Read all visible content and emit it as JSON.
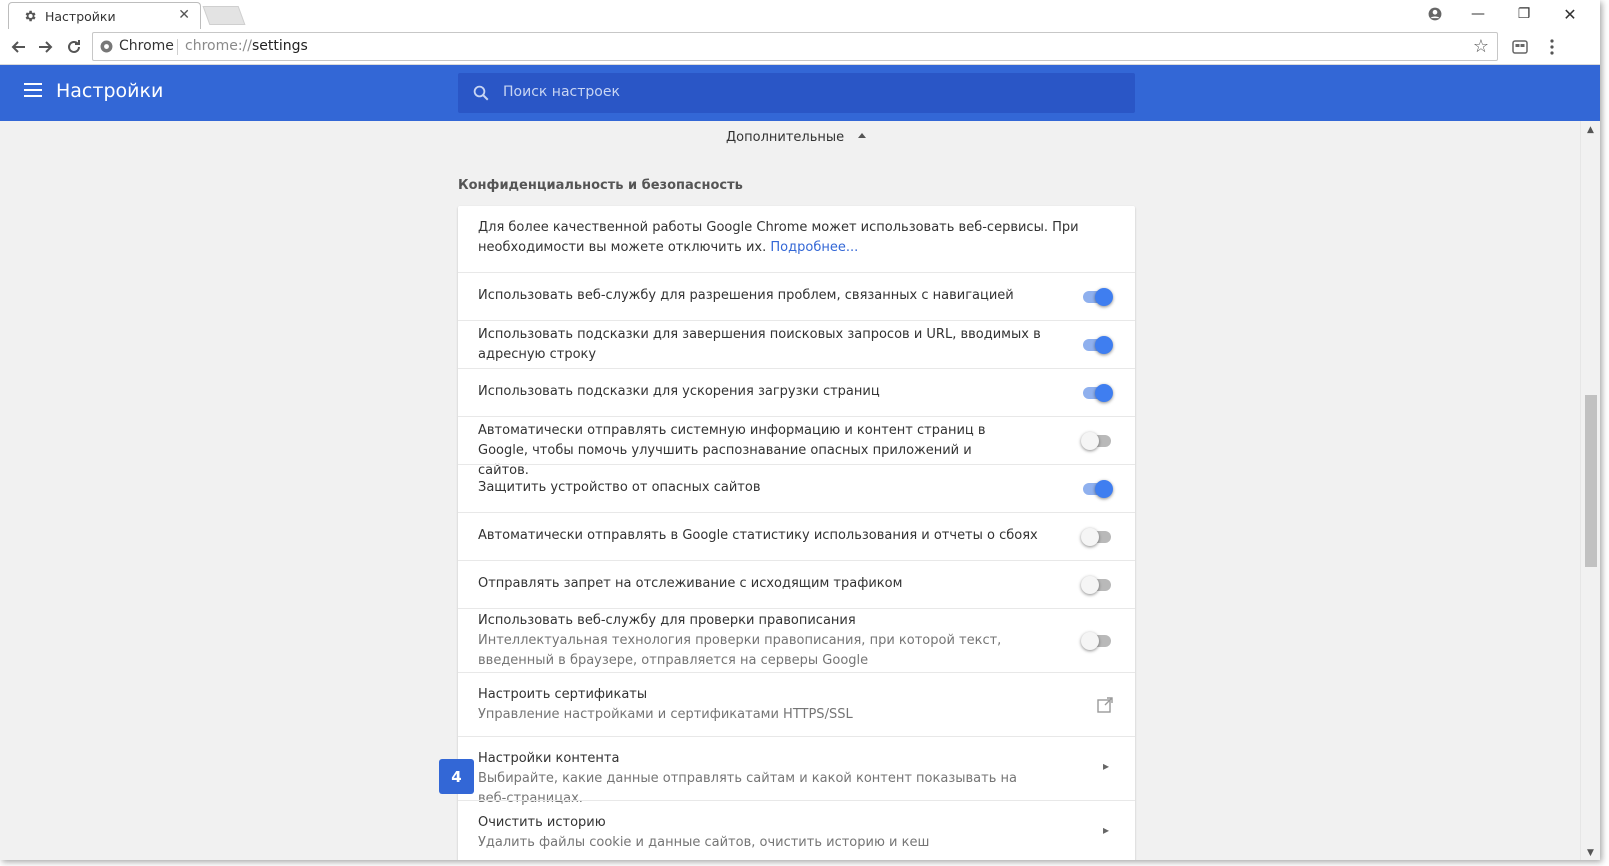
{
  "tab": {
    "title": "Настройки",
    "close": "✕"
  },
  "window": {
    "minimize": "—",
    "restore": "❐",
    "close": "✕"
  },
  "toolbar": {
    "chip": "Chrome",
    "url_scheme": "chrome://",
    "url_path": "settings",
    "star": "☆"
  },
  "header": {
    "title": "Настройки",
    "search_placeholder": "Поиск настроек"
  },
  "advanced": {
    "label": "Дополнительные"
  },
  "section": {
    "title": "Конфиденциальность и безопасность",
    "intro_text": "Для более качественной работы Google Chrome может использовать веб-сервисы. При необходимости вы можете отключить их.",
    "intro_link": "Подробнее...",
    "rows": [
      {
        "label": "Использовать веб-службу для разрешения проблем, связанных с навигацией",
        "toggle": true
      },
      {
        "label": "Использовать подсказки для завершения поисковых запросов и URL, вводимых в адресную строку",
        "toggle": true
      },
      {
        "label": "Использовать подсказки для ускорения загрузки страниц",
        "toggle": true
      },
      {
        "label": "Автоматически отправлять системную информацию и контент страниц в Google, чтобы помочь улучшить распознавание опасных приложений и сайтов.",
        "toggle": false
      },
      {
        "label": "Защитить устройство от опасных сайтов",
        "toggle": true
      },
      {
        "label": "Автоматически отправлять в Google статистику использования и отчеты о сбоях",
        "toggle": false
      },
      {
        "label": "Отправлять запрет на отслеживание с исходящим трафиком",
        "toggle": false
      },
      {
        "label": "Использовать веб-службу для проверки правописания",
        "sub": "Интеллектуальная технология проверки правописания, при которой текст, введенный в браузере, отправляется на серверы Google",
        "toggle": false
      },
      {
        "label": "Настроить сертификаты",
        "sub": "Управление настройками и сертификатами HTTPS/SSL"
      },
      {
        "label": "Настройки контента",
        "sub": "Выбирайте, какие данные отправлять сайтам и какой контент показывать на веб-страницах."
      },
      {
        "label": "Очистить историю",
        "sub": "Удалить файлы cookie и данные сайтов, очистить историю и кеш"
      }
    ]
  },
  "badge": "4",
  "colors": {
    "header": "#3367d6",
    "toggle_on": "#3f7ef0",
    "link": "#3367d6"
  }
}
